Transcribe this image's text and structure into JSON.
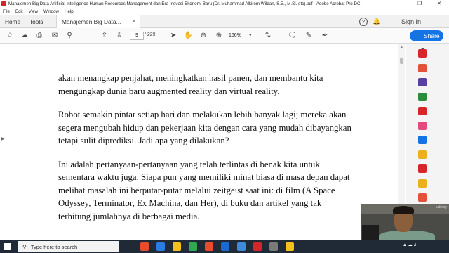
{
  "window": {
    "title": "Manajemen Big Data Artificial Intelligence Human Resources Management dan Era Inovasi Ekonomi Baru (Dr. Muhammad Alkirom Wildan, S.E., M.Si. etc).pdf - Adobe Acrobat Pro DC",
    "controls": [
      "–",
      "❐",
      "✕"
    ]
  },
  "menu": [
    "File",
    "Edit",
    "View",
    "Window",
    "Help"
  ],
  "tabs": {
    "home": "Home",
    "tools": "Tools",
    "doc": "Manajemen Big Data...",
    "close": "×"
  },
  "header_right": {
    "help": "?",
    "sign_in": "Sign In"
  },
  "toolbar": {
    "page_current": "9",
    "page_total": "/ 229",
    "zoom": "166%",
    "share_label": "Share"
  },
  "document": {
    "paragraphs": [
      "akan menangkap penjahat, meningkatkan hasil panen, dan membantu kita mengungkap dunia baru augmented reality dan virtual reality.",
      "Robot semakin pintar setiap hari dan melakukan lebih banyak lagi; mereka akan segera mengubah hidup dan pekerjaan kita dengan cara yang mudah dibayangkan tetapi sulit diprediksi. Jadi apa yang dilakukan?",
      "Ini adalah pertanyaan-pertanyaan yang telah terlintas di benak kita untuk sementara waktu juga. Siapa pun yang memiliki minat biasa di masa depan dapat melihat masalah ini berputar-putar melalui zeitgeist saat ini: di film (A Space Odyssey, Terminator, Ex Machina, dan Her), di buku dan artikel yang tak terhitung jumlahnya di berbagai media."
    ]
  },
  "taskbar": {
    "search_placeholder": "Type here to search"
  },
  "webcam": {
    "watermark": "udemy"
  },
  "right_panel_colors": [
    "#d7262b",
    "#e3513b",
    "#5a3fa3",
    "#2a8c3d",
    "#d7262b",
    "#e34b7c",
    "#1473e6",
    "#ecb01d",
    "#d7262b",
    "#ecb01d",
    "#e3513b",
    "#d7262b"
  ],
  "taskbar_app_colors": [
    "#e94c2b",
    "#2a7be4",
    "#f4c21b",
    "#2ea94f",
    "#e94c2b",
    "#1b6ad1",
    "#3c8cdb",
    "#d7262b",
    "#7a7a7a",
    "#f4c21b"
  ]
}
